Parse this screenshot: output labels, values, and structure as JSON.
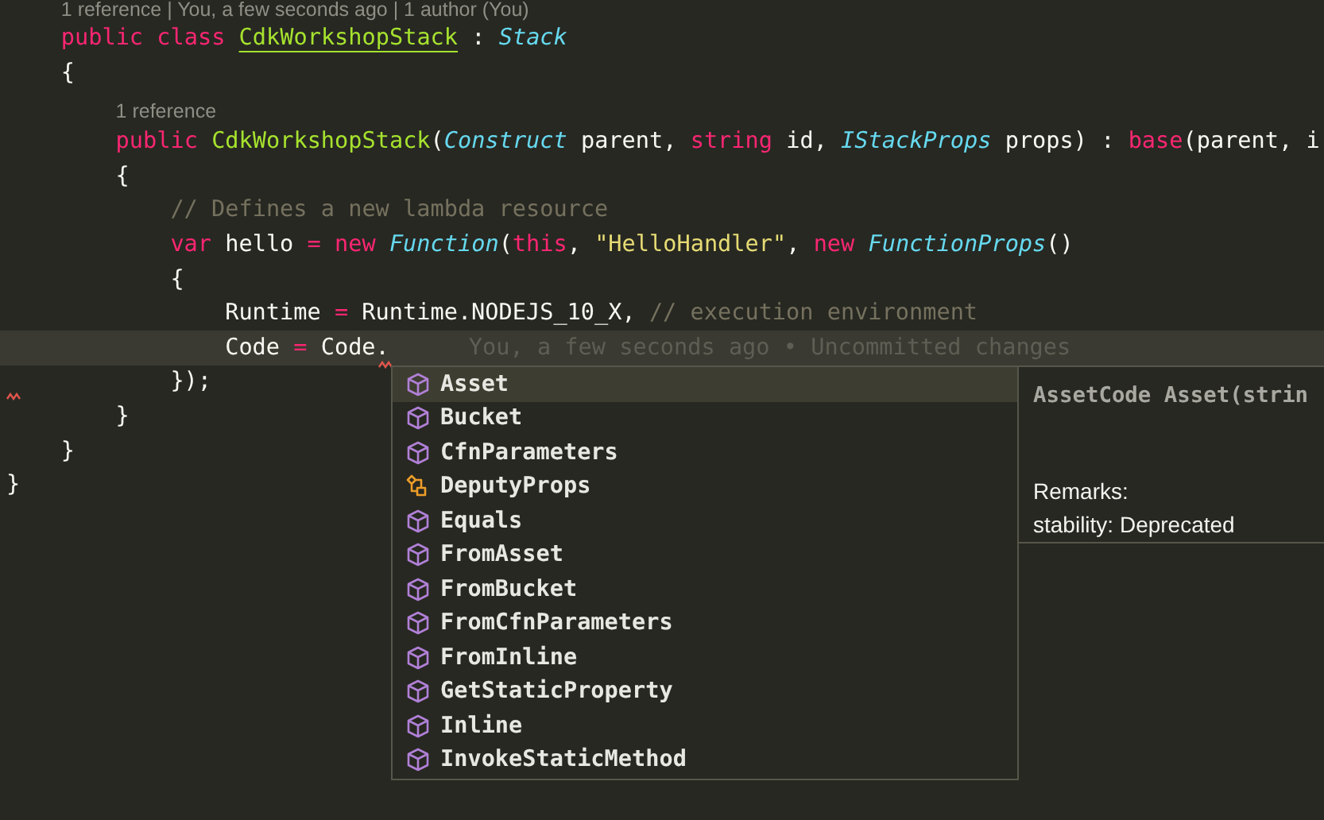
{
  "editor": {
    "lines": [
      {
        "kind": "block",
        "children": [
          {
            "kind": "lens",
            "text": "1 reference | You, a few seconds ago | 1 author (You)",
            "current": false
          },
          {
            "kind": "code",
            "current": false,
            "tokens": [
              {
                "kind": "kw",
                "text": "public class "
              },
              {
                "kind": "cls-u",
                "text": "CdkWorkshopStack"
              },
              {
                "kind": "plain",
                "text": " : "
              },
              {
                "kind": "type",
                "text": "Stack"
              }
            ]
          },
          {
            "kind": "code",
            "current": false,
            "tokens": [
              {
                "kind": "plain",
                "text": "{"
              }
            ],
            "children": [
              {
                "kind": "lens",
                "text": "1 reference",
                "current": false
              },
              {
                "kind": "code",
                "current": false,
                "tokens": [
                  {
                    "kind": "kw",
                    "text": "public "
                  },
                  {
                    "kind": "cls",
                    "text": "CdkWorkshopStack"
                  },
                  {
                    "kind": "plain",
                    "text": "("
                  },
                  {
                    "kind": "type",
                    "text": "Construct"
                  },
                  {
                    "kind": "plain",
                    "text": " parent, "
                  },
                  {
                    "kind": "kw",
                    "text": "string"
                  },
                  {
                    "kind": "plain",
                    "text": " id, "
                  },
                  {
                    "kind": "type",
                    "text": "IStackProps"
                  },
                  {
                    "kind": "plain",
                    "text": " props) : "
                  },
                  {
                    "kind": "kw",
                    "text": "base"
                  },
                  {
                    "kind": "plain",
                    "text": "(parent, i"
                  }
                ]
              },
              {
                "kind": "code",
                "current": false,
                "tokens": [
                  {
                    "kind": "plain",
                    "text": "{"
                  }
                ],
                "children": [
                  {
                    "kind": "code",
                    "current": false,
                    "tokens": [
                      {
                        "kind": "cmt",
                        "text": "// Defines a new lambda resource"
                      }
                    ]
                  },
                  {
                    "kind": "code",
                    "current": false,
                    "tokens": [
                      {
                        "kind": "kw",
                        "text": "var"
                      },
                      {
                        "kind": "plain",
                        "text": " hello "
                      },
                      {
                        "kind": "kw",
                        "text": "= new "
                      },
                      {
                        "kind": "type",
                        "text": "Function"
                      },
                      {
                        "kind": "plain",
                        "text": "("
                      },
                      {
                        "kind": "kw",
                        "text": "this"
                      },
                      {
                        "kind": "plain",
                        "text": ", "
                      },
                      {
                        "kind": "str",
                        "text": "\"HelloHandler\""
                      },
                      {
                        "kind": "plain",
                        "text": ", "
                      },
                      {
                        "kind": "kw",
                        "text": "new "
                      },
                      {
                        "kind": "type",
                        "text": "FunctionProps"
                      },
                      {
                        "kind": "plain",
                        "text": "()"
                      }
                    ]
                  },
                  {
                    "kind": "code",
                    "current": false,
                    "tokens": [
                      {
                        "kind": "plain",
                        "text": "{"
                      }
                    ],
                    "children": [
                      {
                        "kind": "code",
                        "current": false,
                        "tokens": [
                          {
                            "kind": "plain",
                            "text": "Runtime "
                          },
                          {
                            "kind": "kw",
                            "text": "="
                          },
                          {
                            "kind": "plain",
                            "text": " Runtime.NODEJS_10_X, "
                          },
                          {
                            "kind": "cmt",
                            "text": "// execution environment"
                          }
                        ]
                      },
                      {
                        "kind": "code",
                        "current": true,
                        "blame": "You, a few seconds ago • Uncommitted changes",
                        "tokens": [
                          {
                            "kind": "plain",
                            "text": "Code "
                          },
                          {
                            "kind": "kw",
                            "text": "="
                          },
                          {
                            "kind": "plain",
                            "text": " Code."
                          }
                        ]
                      }
                    ]
                  },
                  {
                    "kind": "code",
                    "current": false,
                    "tokens": [
                      {
                        "kind": "plain",
                        "text": "});"
                      }
                    ]
                  }
                ]
              },
              {
                "kind": "code",
                "current": false,
                "tokens": [
                  {
                    "kind": "plain",
                    "text": "}"
                  }
                ]
              }
            ]
          },
          {
            "kind": "code",
            "current": false,
            "tokens": [
              {
                "kind": "plain",
                "text": "}"
              }
            ]
          }
        ]
      },
      {
        "kind": "code",
        "current": false,
        "tokens": [
          {
            "kind": "plain",
            "text": "}"
          }
        ]
      }
    ]
  },
  "suggestions": {
    "items": [
      {
        "label": "Asset",
        "kind": "method",
        "selected": true
      },
      {
        "label": "Bucket",
        "kind": "method",
        "selected": false
      },
      {
        "label": "CfnParameters",
        "kind": "method",
        "selected": false
      },
      {
        "label": "DeputyProps",
        "kind": "struct",
        "selected": false
      },
      {
        "label": "Equals",
        "kind": "method",
        "selected": false
      },
      {
        "label": "FromAsset",
        "kind": "method",
        "selected": false
      },
      {
        "label": "FromBucket",
        "kind": "method",
        "selected": false
      },
      {
        "label": "FromCfnParameters",
        "kind": "method",
        "selected": false
      },
      {
        "label": "FromInline",
        "kind": "method",
        "selected": false
      },
      {
        "label": "GetStaticProperty",
        "kind": "method",
        "selected": false
      },
      {
        "label": "Inline",
        "kind": "method",
        "selected": false
      },
      {
        "label": "InvokeStaticMethod",
        "kind": "method",
        "selected": false
      }
    ]
  },
  "details": {
    "signature": "AssetCode Asset(strin",
    "remarks": [
      "Remarks:",
      "stability: Deprecated"
    ]
  }
}
